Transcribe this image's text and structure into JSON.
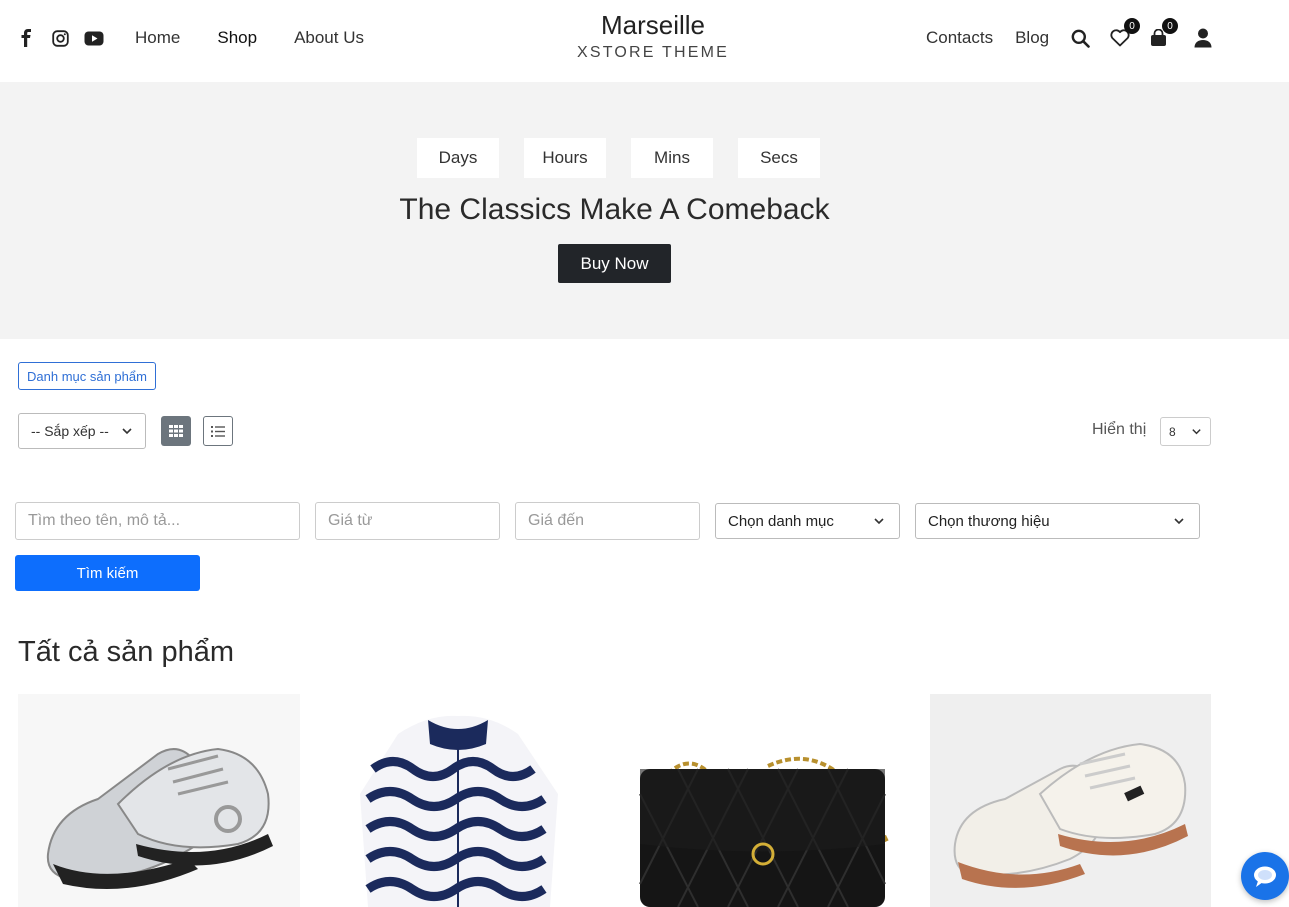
{
  "header": {
    "social": [
      "facebook-icon",
      "instagram-icon",
      "youtube-icon"
    ],
    "nav_left": [
      "Home",
      "Shop",
      "About Us"
    ],
    "brand_title": "Marseille",
    "brand_sub": "XSTORE THEME",
    "nav_right": [
      "Contacts",
      "Blog"
    ],
    "wishlist_count": "0",
    "cart_count": "0"
  },
  "hero": {
    "countdown": [
      "Days",
      "Hours",
      "Mins",
      "Secs"
    ],
    "title": "The Classics Make A Comeback",
    "button": "Buy Now"
  },
  "filters": {
    "category_button": "Danh mục sản phẩm",
    "sort_value": "-- Sắp xếp --",
    "show_label": "Hiển thị",
    "show_value": "8",
    "search_placeholder": "Tìm theo tên, mô tả...",
    "price_from_placeholder": "Giá từ",
    "price_to_placeholder": "Giá đến",
    "category_select": "Chọn danh mục",
    "brand_select": "Chọn thương hiệu",
    "search_button": "Tìm kiếm"
  },
  "products": {
    "section_title": "Tất cả sản phẩm",
    "items": [
      "silver-sneakers-image",
      "patterned-hoodie-image",
      "black-quilted-bag-image",
      "white-sneakers-image"
    ]
  },
  "colors": {
    "accent": "#0d6efd",
    "dark": "#222529",
    "hero_bg": "#f3f3f3"
  }
}
